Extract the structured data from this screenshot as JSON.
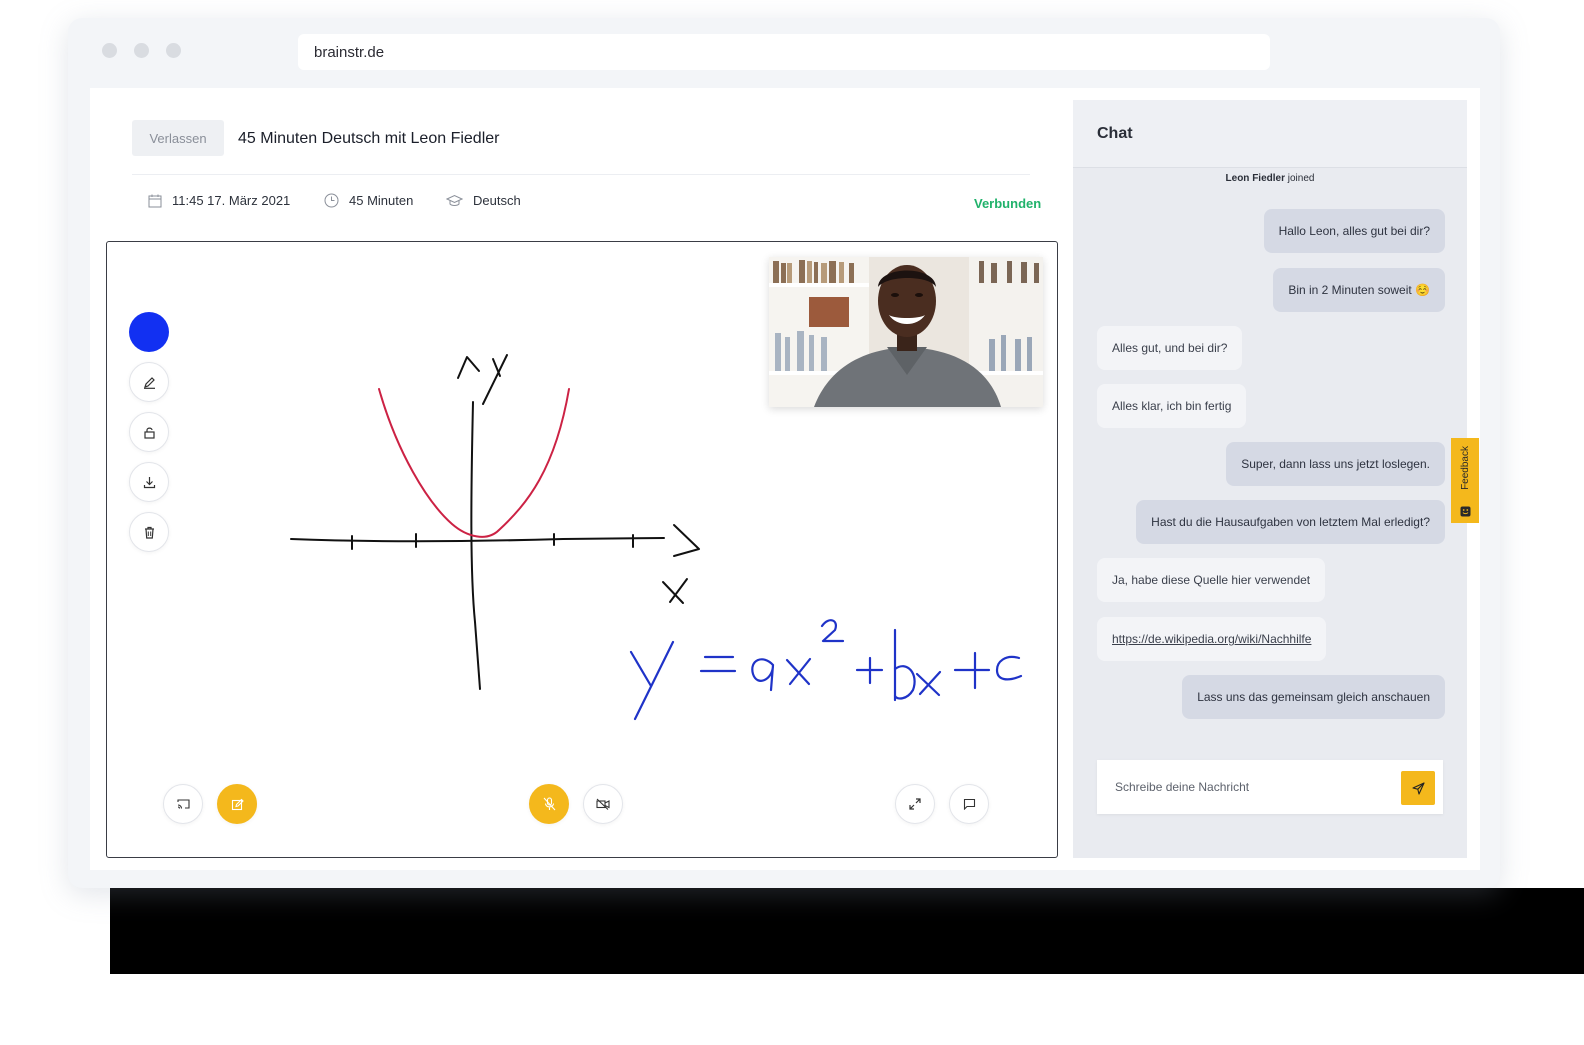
{
  "browser": {
    "url": "brainstr.de"
  },
  "header": {
    "leave_label": "Verlassen",
    "title": "45 Minuten Deutsch mit Leon Fiedler",
    "datetime": "11:45 17. März 2021",
    "duration": "45 Minuten",
    "subject": "Deutsch",
    "status": "Verbunden"
  },
  "whiteboard": {
    "pen_color": "#1230f2",
    "graph_color": "#cc2244",
    "equation_color": "#1f33c8",
    "tools": [
      "pencil-icon",
      "lock-icon",
      "download-icon",
      "trash-icon"
    ],
    "handwriting": {
      "axis_y": "y",
      "axis_x": "x",
      "equation": "y = ax² + bx + c"
    }
  },
  "controls": {
    "left": [
      "cast-icon",
      "edit-icon"
    ],
    "center": [
      "mic-off-icon",
      "video-off-icon"
    ],
    "right": [
      "expand-icon",
      "chat-bubble-icon"
    ]
  },
  "chat": {
    "title": "Chat",
    "joined_name": "Leon Fiedler",
    "joined_text": "joined",
    "messages": [
      {
        "side": "out",
        "text": "Hallo Leon, alles gut bei dir?"
      },
      {
        "side": "out",
        "text": "Bin in 2 Minuten soweit ☺️"
      },
      {
        "side": "in",
        "text": "Alles gut, und bei dir?"
      },
      {
        "side": "in",
        "text": "Alles klar, ich bin fertig"
      },
      {
        "side": "out",
        "text": "Super, dann lass uns jetzt loslegen."
      },
      {
        "side": "out",
        "text": "Hast du die Hausaufgaben von letztem Mal erledigt?"
      },
      {
        "side": "in",
        "text": "Ja, habe diese Quelle hier verwendet"
      },
      {
        "side": "in",
        "text": "https://de.wikipedia.org/wiki/Nachhilfe",
        "link": true
      },
      {
        "side": "out",
        "text": "Lass uns das gemeinsam gleich anschauen"
      }
    ],
    "input_placeholder": "Schreibe deine Nachricht",
    "accent": "#f4b81c"
  },
  "feedback_label": "Feedback"
}
